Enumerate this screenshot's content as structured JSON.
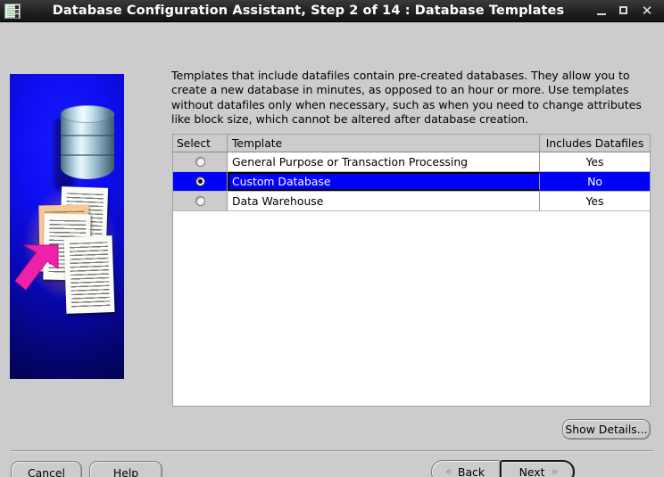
{
  "window": {
    "title": "Database Configuration Assistant, Step 2 of 14 : Database Templates",
    "icon": "app-icon",
    "controls": {
      "minimize": "_",
      "maximize": "□",
      "close": "✕"
    }
  },
  "banner": {
    "alt": "database-templates-illustration",
    "background_color": "#0000cc",
    "accent_color": "#ff00aa"
  },
  "description": "Templates that include datafiles contain pre-created databases. They allow you to create a new database in minutes, as opposed to an hour or more. Use templates without datafiles only when necessary, such as when you need to change attributes like block size, which cannot be altered after database creation.",
  "table": {
    "columns": [
      "Select",
      "Template",
      "Includes Datafiles"
    ],
    "rows": [
      {
        "selected": false,
        "template": "General Purpose or Transaction Processing",
        "datafiles": "Yes"
      },
      {
        "selected": true,
        "template": "Custom Database",
        "datafiles": "No"
      },
      {
        "selected": false,
        "template": "Data Warehouse",
        "datafiles": "Yes"
      }
    ],
    "selection_color": "#0000ff"
  },
  "buttons": {
    "show_details": "Show Details...",
    "cancel": "Cancel",
    "help": "Help",
    "back": "Back",
    "back_mnemonic": "B",
    "back_rest": "ack",
    "next": "Next",
    "next_mnemonic": "N",
    "next_rest": "ext",
    "chevron_left": "«",
    "chevron_right": "»"
  }
}
